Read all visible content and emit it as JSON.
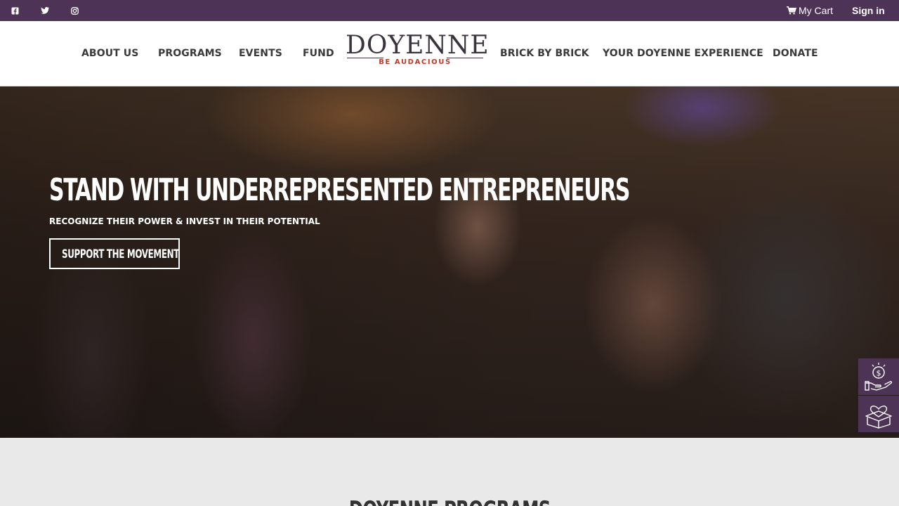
{
  "topbar": {
    "social": [
      "facebook-icon",
      "twitter-icon",
      "instagram-icon"
    ],
    "cart_label": "My Cart",
    "signin_label": "Sign in"
  },
  "nav": {
    "left": [
      "ABOUT US",
      "PROGRAMS",
      "EVENTS",
      "FUND"
    ],
    "right": [
      "BRICK BY BRICK",
      "YOUR DOYENNE EXPERIENCE",
      "DONATE"
    ]
  },
  "logo": {
    "name": "DOYENNE",
    "tagline": "BE AUDACIOUS"
  },
  "hero": {
    "title": "STAND WITH UNDERREPRESENTED ENTREPRENEURS",
    "subtitle": "RECOGNIZE THEIR POWER & INVEST IN THEIR POTENTIAL",
    "cta_label": "SUPPORT THE MOVEMENT"
  },
  "side_widgets": [
    "donate-hand-coin-icon",
    "gift-box-heart-icon"
  ],
  "programs": {
    "title": "DOYENNE PROGRAMS"
  },
  "colors": {
    "brand_purple": "#4d3456",
    "accent_red": "#c0392b",
    "nav_text": "#3a3a3a",
    "section_bg": "#e9e9e9"
  }
}
